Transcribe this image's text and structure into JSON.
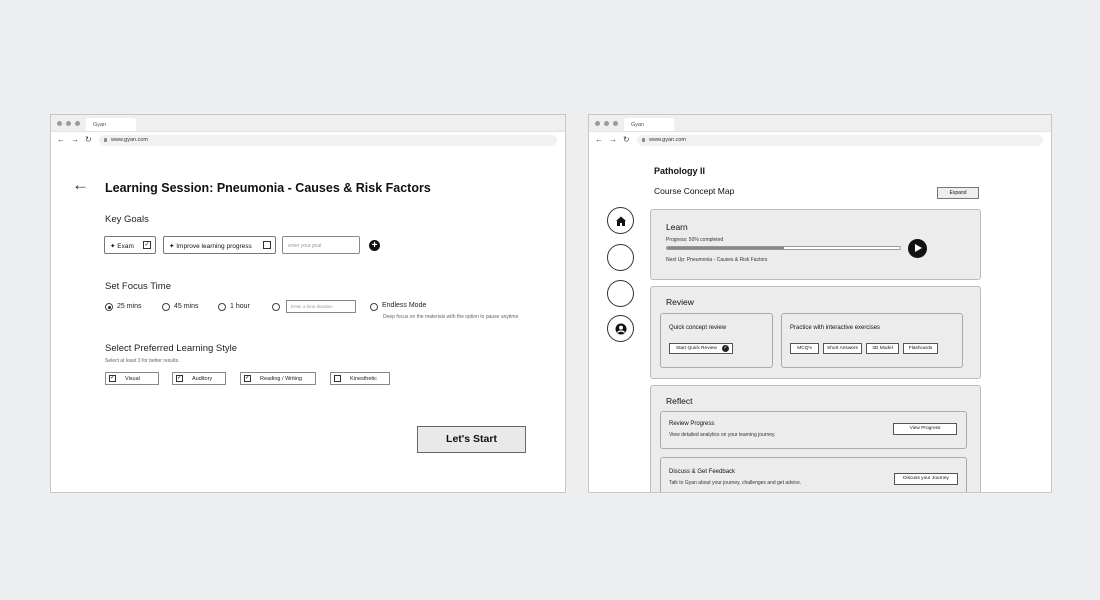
{
  "left_window": {
    "tab_title": "Gyan",
    "url": "www.gyan.com",
    "session_title": "Learning Session: Pneumonia - Causes & Risk Factors",
    "key_goals": {
      "heading": "Key Goals",
      "chips": [
        {
          "label": "✦ Exam",
          "checked": true
        },
        {
          "label": "✦ Improve learning progress",
          "checked": false
        }
      ],
      "input_placeholder": "enter your goal"
    },
    "focus_time": {
      "heading": "Set Focus Time",
      "options": [
        "25 mins",
        "45 mins",
        "1 hour"
      ],
      "selected": "25 mins",
      "custom_placeholder": "Enter a time duration",
      "endless_label": "Endless Mode",
      "endless_desc": "Deep focus on the materials with the option to pause anytime"
    },
    "learning_style": {
      "heading": "Select Preferred Learning Style",
      "hint": "Select at least 3 for better results.",
      "options": [
        {
          "label": "Visual",
          "checked": true
        },
        {
          "label": "Auditory",
          "checked": true
        },
        {
          "label": "Reading / Writing",
          "checked": true
        },
        {
          "label": "Kinesthetic",
          "checked": false
        }
      ]
    },
    "start_label": "Let's Start"
  },
  "right_window": {
    "tab_title": "Gyan",
    "url": "www.gyan.com",
    "course_title": "Pathology II",
    "map_title": "Course Concept Map",
    "expand_label": "Expand",
    "sidebar_icons": [
      "home-icon",
      "empty",
      "empty",
      "user-icon"
    ],
    "learn": {
      "title": "Learn",
      "progress_text": "Progress: 50% completed",
      "progress_percent": 50,
      "next_up": "Next Up: Pneumonia - Causes & Risk Factors"
    },
    "review": {
      "title": "Review",
      "quick": {
        "title": "Quick concept review",
        "button": "Start Quick Review"
      },
      "practice": {
        "title": "Practice with interactive exercises",
        "buttons": [
          "MCQ's",
          "Short Answers",
          "3D Model",
          "Flashcards"
        ]
      }
    },
    "reflect": {
      "title": "Reflect",
      "items": [
        {
          "title": "Review Progress",
          "desc": "View detailed analytics on your learning journey.",
          "button": "View Progress"
        },
        {
          "title": "Discuss & Get Feedback",
          "desc": "Talk to Gyan about your journey, challenges and get advice.",
          "button": "Discuss your Journey"
        }
      ]
    }
  }
}
